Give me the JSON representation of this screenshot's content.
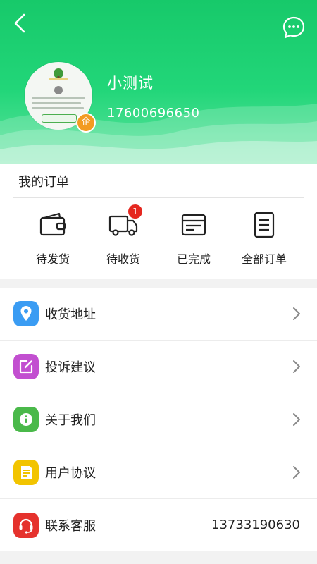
{
  "profile": {
    "name": "小测试",
    "phone": "17600696650",
    "badge": "企"
  },
  "orders": {
    "title": "我的订单",
    "items": [
      {
        "label": "待发货",
        "icon": "wallet-icon"
      },
      {
        "label": "待收货",
        "icon": "truck-icon",
        "badge": "1"
      },
      {
        "label": "已完成",
        "icon": "box-icon"
      },
      {
        "label": "全部订单",
        "icon": "document-icon"
      }
    ]
  },
  "menu": {
    "items": [
      {
        "label": "收货地址",
        "icon": "location-pin-icon",
        "color": "#3a9cf3"
      },
      {
        "label": "投诉建议",
        "icon": "edit-icon",
        "color": "#c24fd0"
      },
      {
        "label": "关于我们",
        "icon": "info-icon",
        "color": "#4ab94a"
      },
      {
        "label": "用户协议",
        "icon": "agreement-icon",
        "color": "#f2c400"
      },
      {
        "label": "联系客服",
        "icon": "headset-icon",
        "color": "#e5322d",
        "value": "13733190630"
      }
    ]
  },
  "colors": {
    "brand_green": "#1ecc6f",
    "badge_red": "#e5271f",
    "enterprise_orange": "#f29b21"
  }
}
